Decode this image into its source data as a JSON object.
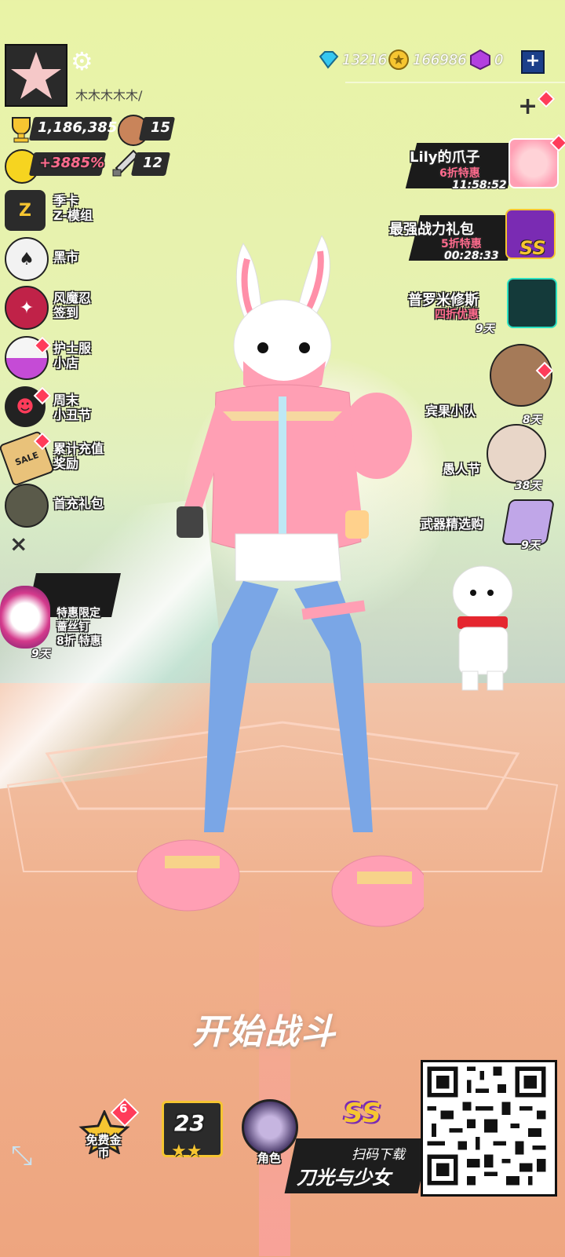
{
  "player": {
    "name": "木木木木木/"
  },
  "currency": {
    "diamonds": "13216",
    "coins": "166986",
    "purple": "0",
    "add": "+"
  },
  "stats": {
    "trophies": "1,186,385",
    "bear_level": "15",
    "bonus": "+3885%",
    "weapon_level": "12"
  },
  "left_menu": [
    {
      "line1": "季卡",
      "line2": "Z-模组",
      "icon": "z-card-icon"
    },
    {
      "line1": "黑市",
      "line2": "",
      "icon": "spade-icon"
    },
    {
      "line1": "风魔忍",
      "line2": "签到",
      "icon": "ninja-icon"
    },
    {
      "line1": "护士服",
      "line2": "小店",
      "icon": "nurse-shop-icon"
    },
    {
      "line1": "周末",
      "line2": "小丑节",
      "icon": "clown-icon"
    },
    {
      "line1": "累计充值",
      "line2": "奖励",
      "icon": "sale-tag-icon"
    },
    {
      "line1": "首充礼包",
      "line2": "",
      "icon": "gift-pouch-icon"
    }
  ],
  "close_symbol": "×",
  "left_promo": {
    "line1": "特惠限定",
    "line2": "蔷丝钉",
    "line3": "8折 特惠",
    "days": "9天"
  },
  "right_offers": [
    {
      "title": "Lily的爪子",
      "sub": "6折特惠",
      "timer": "11:58:52"
    },
    {
      "title": "最强战力礼包",
      "sub": "5折特惠",
      "timer": "00:28:33",
      "badge": "SS"
    },
    {
      "title": "普罗米修斯",
      "sub": "四折优惠",
      "timer": "9天"
    },
    {
      "title": "宾果小队",
      "sub": "",
      "timer": "8天"
    },
    {
      "title": "愚人节",
      "sub": "",
      "timer": "38天"
    },
    {
      "title": "武器精选购",
      "sub": "",
      "timer": "9天"
    }
  ],
  "start_label": "开始战斗",
  "bottom": {
    "free_coins": "免费金币",
    "free_badge": "6",
    "level": "23",
    "character_label": "角色",
    "ss_label": "SS",
    "scan_line1": "扫码下载",
    "scan_line2": "刀光与少女"
  },
  "colors": {
    "accent_pink": "#ff6b8d",
    "dark": "#222222",
    "gold": "#f6c531"
  }
}
